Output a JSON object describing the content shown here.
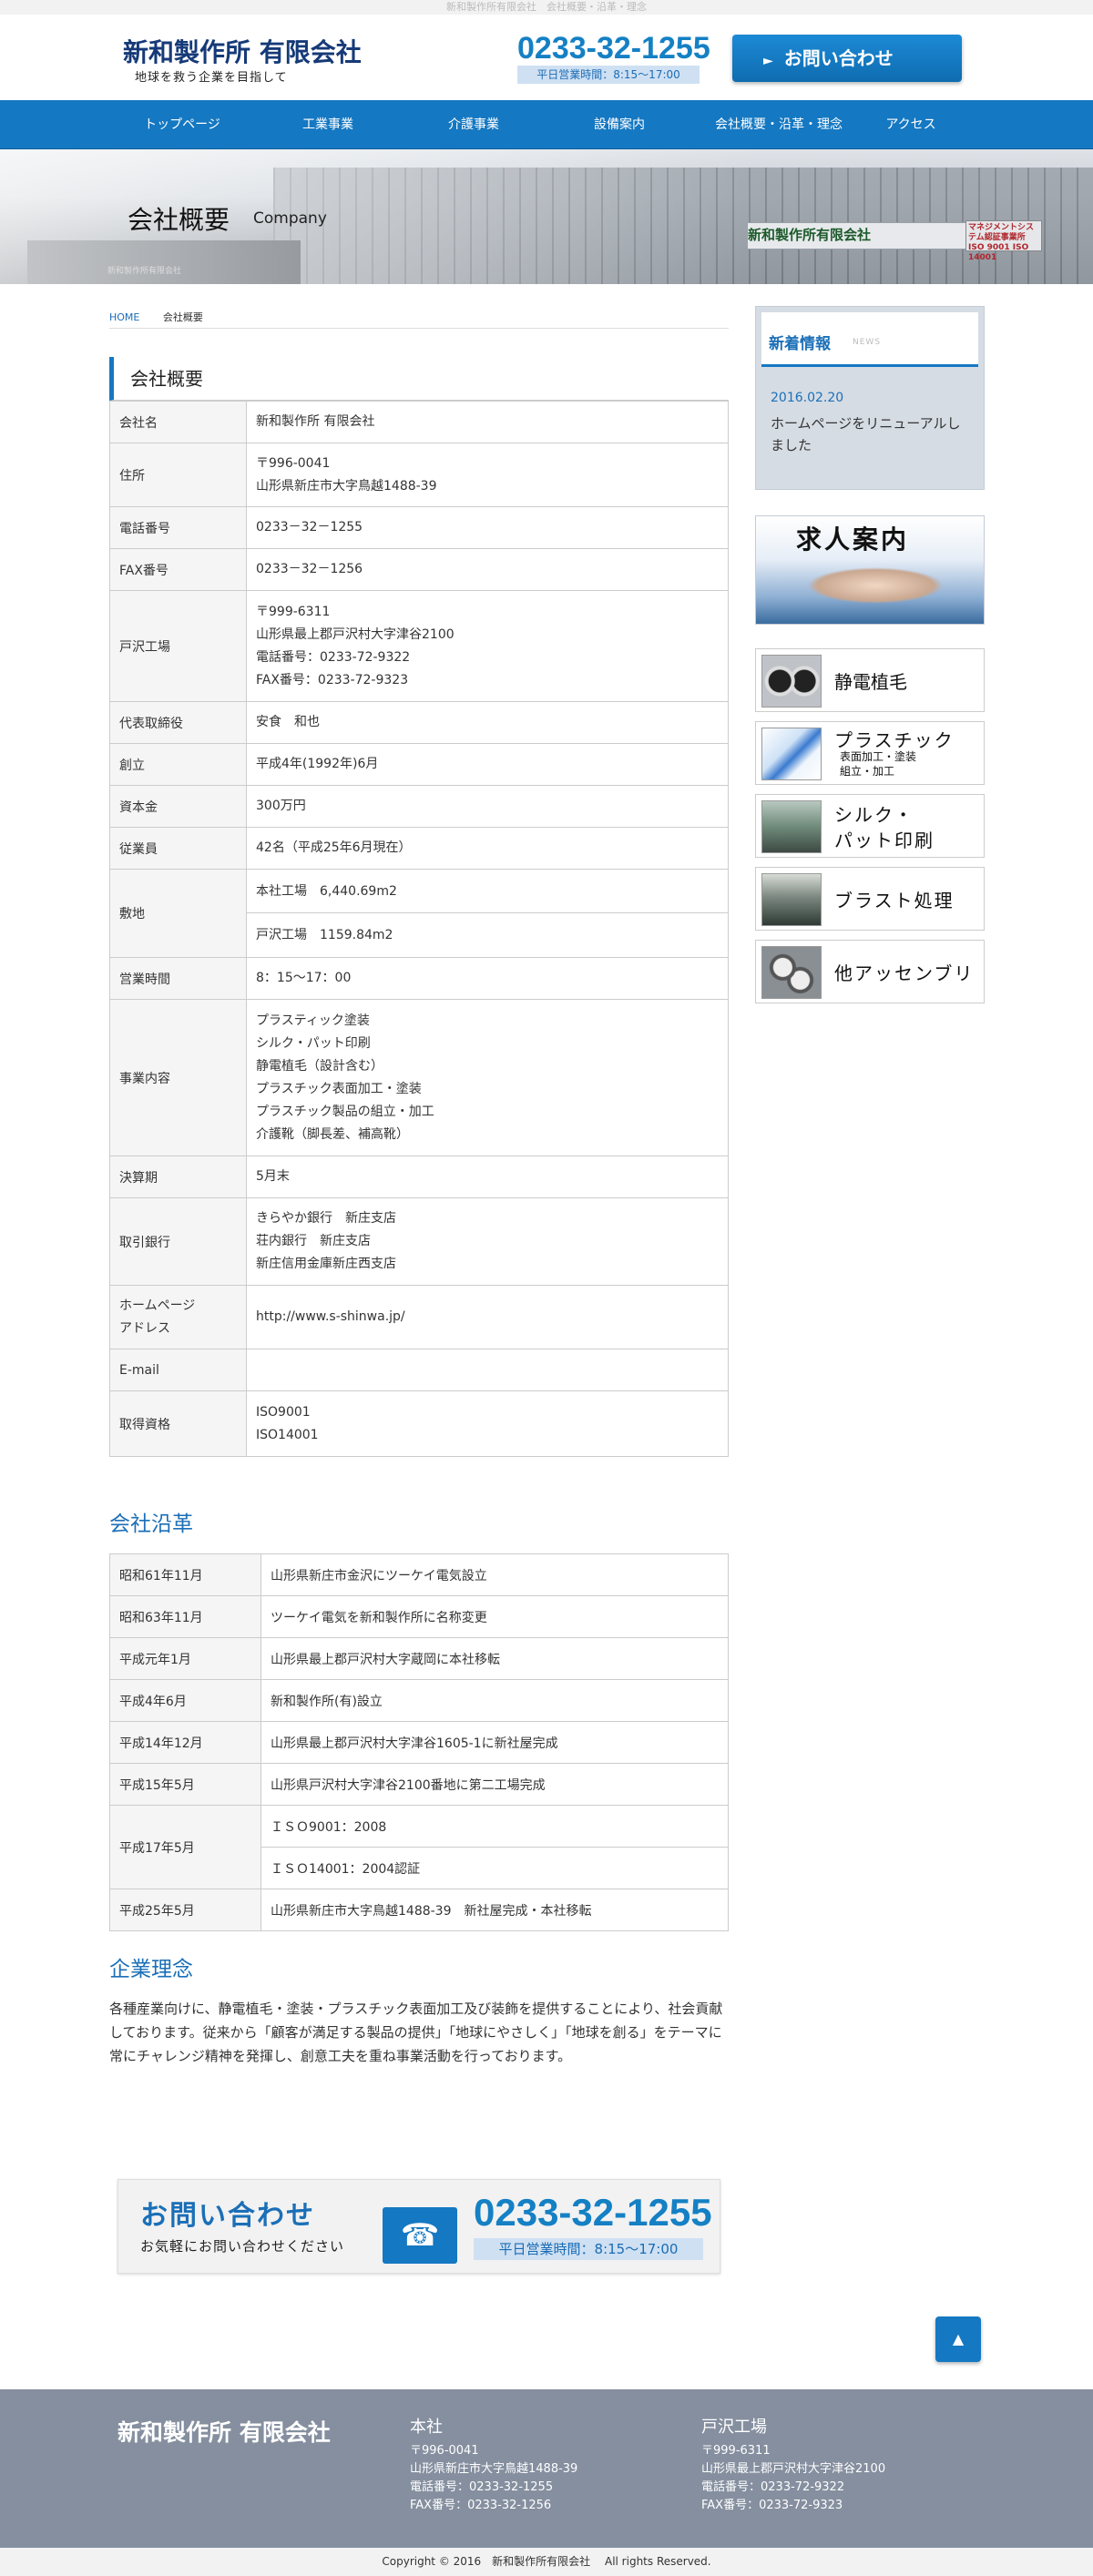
{
  "topbar": {
    "text": "新和製作所有限会社　会社概要・沿革・理念"
  },
  "header": {
    "company_name": "新和製作所 有限会社",
    "tagline": "地球を救う企業を目指して",
    "tel": "0233-32-1255",
    "hours": "平日営業時間：8:15〜17:00",
    "contact_button": "お問い合わせ",
    "contact_arrow": "►"
  },
  "nav": {
    "items": [
      "トップページ",
      "工業事業",
      "介護事業",
      "設備案内",
      "会社概要・沿革・理念",
      "アクセス"
    ]
  },
  "hero": {
    "title": "会社概要",
    "title_en": "Company",
    "sign": "新和製作所有限会社",
    "iso": "マネジメントシステム認証事業所 ISO 9001 ISO 14001",
    "small_sign": "新和製作所有限会社"
  },
  "breadcrumb": {
    "home": "HOME",
    "current": "会社概要"
  },
  "overview": {
    "heading": "会社概要",
    "rows": [
      {
        "key": "会社名",
        "lines": [
          "新和製作所 有限会社"
        ]
      },
      {
        "key": "住所",
        "lines": [
          "〒996-0041",
          "山形県新庄市大字鳥越1488-39"
        ]
      },
      {
        "key": "電話番号",
        "lines": [
          "0233－32－1255"
        ]
      },
      {
        "key": "FAX番号",
        "lines": [
          "0233－32－1256"
        ]
      },
      {
        "key": "戸沢工場",
        "lines": [
          "〒999-6311",
          "山形県最上郡戸沢村大字津谷2100",
          "電話番号：0233-72-9322",
          "FAX番号：0233-72-9323"
        ]
      },
      {
        "key": "代表取締役",
        "lines": [
          "安食　和也"
        ]
      },
      {
        "key": "創立",
        "lines": [
          "平成4年(1992年)6月"
        ]
      },
      {
        "key": "資本金",
        "lines": [
          "300万円"
        ]
      },
      {
        "key": "従業員",
        "lines": [
          "42名（平成25年6月現在）"
        ]
      },
      {
        "key": "敷地",
        "lines": [
          "本社工場　6,440.69m2",
          "戸沢工場　1159.84m2"
        ]
      },
      {
        "key": "営業時間",
        "lines": [
          "8：15〜17：00"
        ]
      },
      {
        "key": "事業内容",
        "lines": [
          "プラスティック塗装",
          "シルク・パット印刷",
          "静電植毛（設計含む）",
          "プラスチック表面加工・塗装",
          "プラスチック製品の組立・加工",
          "介護靴（脚長差、補高靴）"
        ]
      },
      {
        "key": "決算期",
        "lines": [
          "5月末"
        ]
      },
      {
        "key": "取引銀行",
        "lines": [
          "きらやか銀行　新庄支店",
          "荘内銀行　新庄支店",
          "新庄信用金庫新庄西支店"
        ]
      },
      {
        "key": "ホームページ\nアドレス",
        "key_lines": [
          "ホームページ",
          "アドレス"
        ],
        "lines": [
          "http://www.s-shinwa.jp/"
        ]
      },
      {
        "key": "E-mail",
        "lines": [
          ""
        ]
      },
      {
        "key": "取得資格",
        "lines": [
          "ISO9001",
          "ISO14001"
        ]
      }
    ]
  },
  "history": {
    "heading": "会社沿革",
    "rows": [
      {
        "date": "昭和61年11月",
        "events": [
          "山形県新庄市金沢にツーケイ電気設立"
        ]
      },
      {
        "date": "昭和63年11月",
        "events": [
          "ツーケイ電気を新和製作所に名称変更"
        ]
      },
      {
        "date": "平成元年1月",
        "events": [
          "山形県最上郡戸沢村大字蔵岡に本社移転"
        ]
      },
      {
        "date": "平成4年6月",
        "events": [
          "新和製作所(有)設立"
        ]
      },
      {
        "date": "平成14年12月",
        "events": [
          "山形県最上郡戸沢村大字津谷1605-1に新社屋完成"
        ]
      },
      {
        "date": "平成15年5月",
        "events": [
          "山形県戸沢村大字津谷2100番地に第二工場完成"
        ]
      },
      {
        "date": "平成17年5月",
        "events": [
          "ＩＳＯ9001：2008",
          "ＩＳＯ14001：2004認証"
        ]
      },
      {
        "date": "平成25年5月",
        "events": [
          "山形県新庄市大字鳥越1488-39　新社屋完成・本社移転"
        ]
      }
    ]
  },
  "philosophy": {
    "heading": "企業理念",
    "text": "各種産業向けに、静電植毛・塗装・プラスチック表面加工及び装飾を提供することにより、社会貢献しております。従来から「顧客が満足する製品の提供」「地球にやさしく」「地球を創る」をテーマに常にチャレンジ精神を発揮し、創意工夫を重ね事業活動を行っております。"
  },
  "contact_box": {
    "title": "お問い合わせ",
    "subtitle": "お気軽にお問い合わせください",
    "tel": "0233-32-1255",
    "hours": "平日営業時間：8:15〜17:00",
    "phone_icon": "☎"
  },
  "to_top": {
    "label": "▲"
  },
  "sidebar": {
    "news": {
      "title": "新着情報",
      "title_en": "NEWS",
      "date": "2016.02.20",
      "text": "ホームページをリニューアルしました"
    },
    "recruit": {
      "title": "求人案内"
    },
    "services": [
      {
        "label": "静電植毛",
        "sub": ""
      },
      {
        "label": "プラスチック",
        "sub": "表面加工・塗装\n組立・加工",
        "sub_lines": [
          "表面加工・塗装",
          "組立・加工"
        ]
      },
      {
        "label": "シルク・\nパット印刷",
        "label_lines": [
          "シルク・",
          "パット印刷"
        ],
        "sub": ""
      },
      {
        "label": "ブラスト処理",
        "sub": ""
      },
      {
        "label": "他アッセンブリ",
        "sub": ""
      }
    ]
  },
  "footer": {
    "company_name": "新和製作所 有限会社",
    "hq": {
      "heading": "本社",
      "lines": [
        "〒996-0041",
        "山形県新庄市大字鳥越1488-39",
        "電話番号：0233-32-1255",
        "FAX番号：0233-32-1256"
      ]
    },
    "plant": {
      "heading": "戸沢工場",
      "lines": [
        "〒999-6311",
        "山形県最上郡戸沢村大字津谷2100",
        "電話番号：0233-72-9322",
        "FAX番号：0233-72-9323"
      ]
    },
    "copyright": "Copyright © 2016　新和製作所有限会社　 All rights Reserved."
  }
}
